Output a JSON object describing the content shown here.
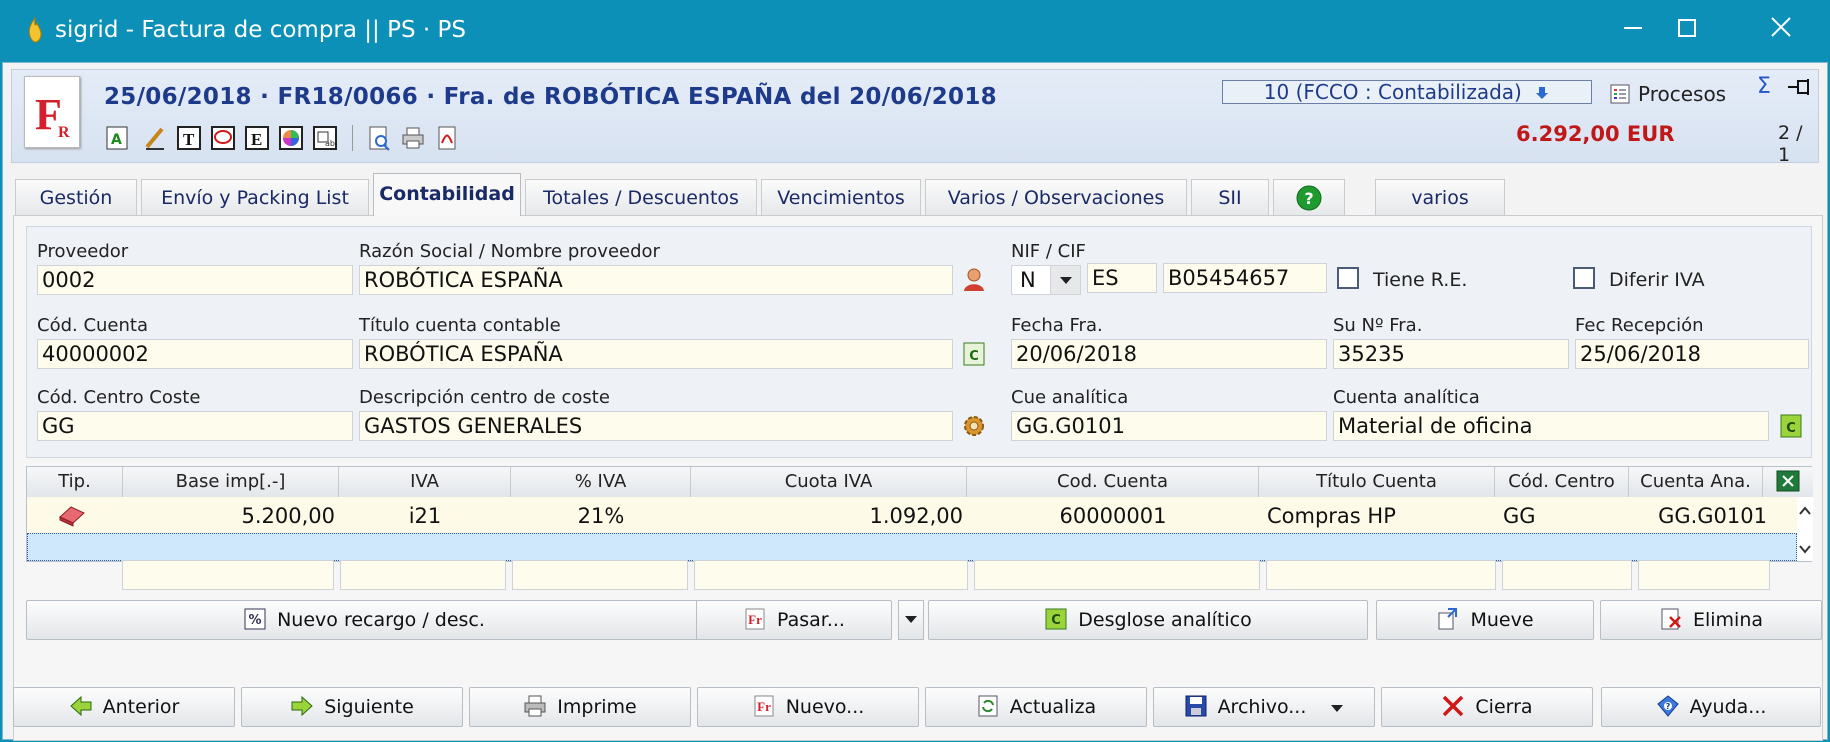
{
  "window": {
    "title": "sigrid - Factura de compra || PS · PS",
    "controls": [
      "minimize",
      "maximize",
      "close"
    ]
  },
  "header": {
    "logo_text": "FR",
    "doc_title": "25/06/2018 · FR18/0066 · Fra. de ROBÓTICA ESPAÑA del 20/06/2018",
    "status": "10 (FCCO : Contabilizada)",
    "procesos_label": "Procesos",
    "amount": "6.292,00 EUR",
    "pager": "2 / 1",
    "toolbar_icons": [
      "text-a-icon",
      "pencil-icon",
      "text-t-icon",
      "speech-bubble-icon",
      "text-e-icon",
      "color-wheel-icon",
      "template-icon",
      "preview-icon",
      "print-icon",
      "pdf-icon"
    ]
  },
  "tabs": [
    {
      "label": "Gestión",
      "active": false
    },
    {
      "label": "Envío y Packing List",
      "active": false
    },
    {
      "label": "Contabilidad",
      "active": true
    },
    {
      "label": "Totales / Descuentos",
      "active": false
    },
    {
      "label": "Vencimientos",
      "active": false
    },
    {
      "label": "Varios / Observaciones",
      "active": false
    },
    {
      "label": "SII",
      "active": false
    },
    {
      "label": "?",
      "active": false
    },
    {
      "label": "varios",
      "active": false
    }
  ],
  "form": {
    "proveedor": {
      "label": "Proveedor",
      "value": "0002"
    },
    "razon_social": {
      "label": "Razón Social / Nombre proveedor",
      "value": "ROBÓTICA ESPAÑA"
    },
    "nif": {
      "label": "NIF / CIF",
      "type": "N",
      "country": "ES",
      "value": "B05454657"
    },
    "tiene_re": {
      "label": "Tiene R.E.",
      "checked": false
    },
    "diferir_iva": {
      "label": "Diferir IVA",
      "checked": false
    },
    "cod_cuenta": {
      "label": "Cód. Cuenta",
      "value": "40000002"
    },
    "titulo_cuenta": {
      "label": "Título cuenta contable",
      "value": "ROBÓTICA ESPAÑA"
    },
    "fecha_fra": {
      "label": "Fecha Fra.",
      "value": "20/06/2018"
    },
    "su_num_fra": {
      "label": "Su Nº Fra.",
      "value": "35235"
    },
    "fec_recepcion": {
      "label": "Fec Recepción",
      "value": "25/06/2018"
    },
    "cod_centro_coste": {
      "label": "Cód. Centro Coste",
      "value": "GG"
    },
    "desc_centro_coste": {
      "label": "Descripción centro de coste",
      "value": "GASTOS GENERALES"
    },
    "cue_analitica": {
      "label": "Cue analítica",
      "value": "GG.G0101"
    },
    "cuenta_analitica": {
      "label": "Cuenta analítica",
      "value": "Material de oficina"
    }
  },
  "grid": {
    "columns": [
      "Tip.",
      "Base imp[.-]",
      "IVA",
      "% IVA",
      "Cuota IVA",
      "Cod. Cuenta",
      "Título Cuenta",
      "Cód. Centro",
      "Cuenta Ana."
    ],
    "rows": [
      {
        "tip": "eraser-icon",
        "base": "5.200,00",
        "iva": "i21",
        "pct": "21%",
        "cuota": "1.092,00",
        "cuenta": "60000001",
        "titulo": "Compras HP",
        "centro": "GG",
        "ana": "GG.G0101"
      }
    ]
  },
  "actions": {
    "nuevo_recargo": "Nuevo recargo / desc.",
    "pasar": "Pasar...",
    "desglose": "Desglose analítico",
    "mueve": "Mueve",
    "elimina": "Elimina"
  },
  "footer": {
    "anterior": "Anterior",
    "siguiente": "Siguiente",
    "imprime": "Imprime",
    "nuevo": "Nuevo...",
    "actualiza": "Actualiza",
    "archivo": "Archivo...",
    "cierra": "Cierra",
    "ayuda": "Ayuda..."
  },
  "colors": {
    "titlebar": "#0c90b8",
    "title_blue": "#1e3a8a",
    "amount_red": "#c01818",
    "field_bg": "#fefcec",
    "selected_row": "#cfe8fb"
  }
}
